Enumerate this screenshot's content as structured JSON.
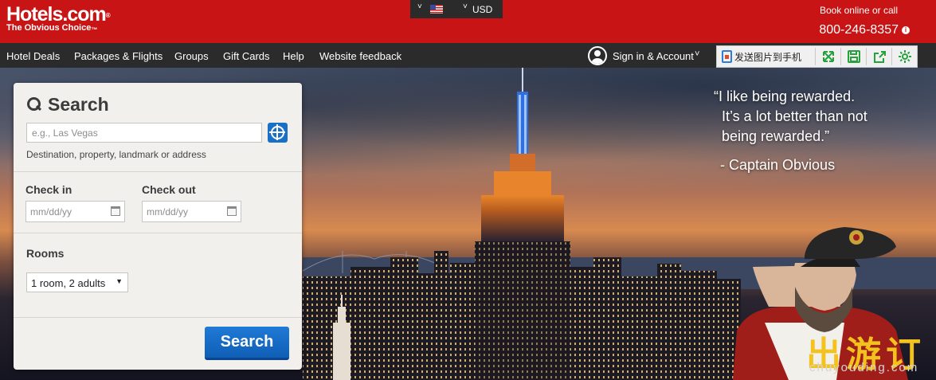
{
  "header": {
    "logo_text": "Hotels.com",
    "logo_registered": "®",
    "tagline": "The Obvious Choice",
    "trademark": "™",
    "locale": {
      "flag_icon": "us-flag-icon",
      "currency": "USD"
    },
    "book_online": "Book online or call",
    "phone": "800-246-8357"
  },
  "nav": {
    "items": [
      {
        "label": "Hotel Deals"
      },
      {
        "label": "Packages & Flights"
      },
      {
        "label": "Groups"
      },
      {
        "label": "Gift Cards"
      },
      {
        "label": "Help"
      },
      {
        "label": "Website feedback"
      }
    ],
    "account_label": "Sign in & Account"
  },
  "extension_toolbar": {
    "send_label": "发送图片到手机",
    "icons": [
      "expand-icon",
      "save-icon",
      "share-icon",
      "settings-icon"
    ],
    "accent": "#27a13b"
  },
  "hero": {
    "quote_lines": [
      "“I like being rewarded.",
      "It’s a lot better than not",
      "being rewarded.”"
    ],
    "quote_author": "- Captain Obvious",
    "watermark": "出游订",
    "watermark_sub": "chuyouding.com"
  },
  "search": {
    "title": "Search",
    "destination_placeholder": "e.g., Las Vegas",
    "destination_helper": "Destination, property, landmark or address",
    "checkin_label": "Check in",
    "checkout_label": "Check out",
    "date_placeholder": "mm/dd/yy",
    "rooms_label": "Rooms",
    "rooms_value": "1 room, 2 adults",
    "button_label": "Search"
  },
  "colors": {
    "brand_red": "#c81414",
    "nav_dark": "#2b2b2b",
    "button_blue": "#1a6fc6"
  }
}
